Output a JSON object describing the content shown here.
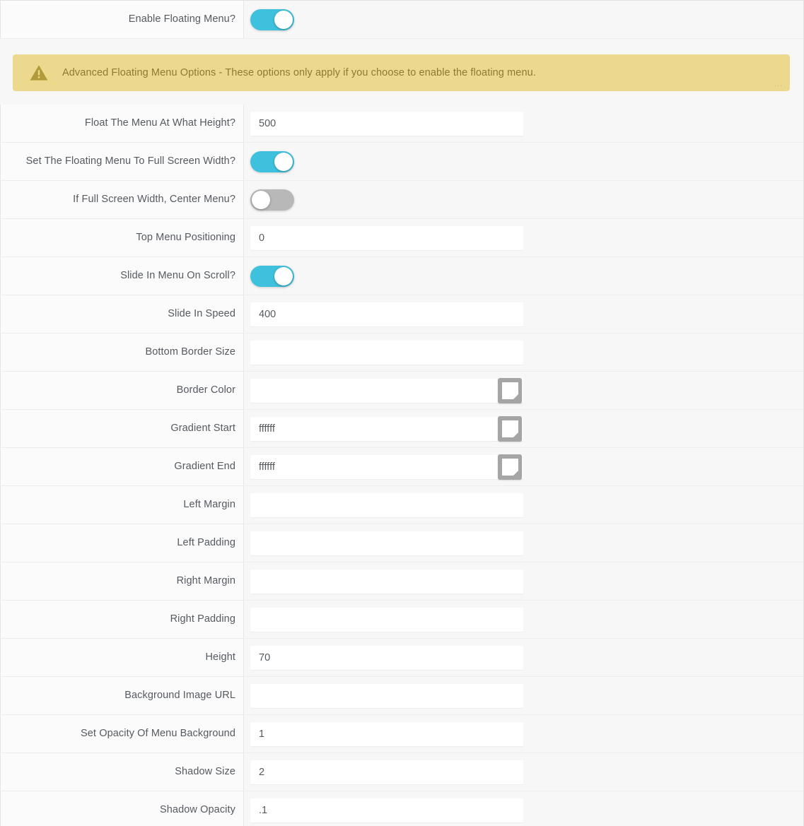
{
  "theme": {
    "accent_on": "#3ec1dd",
    "accent_off": "#b8b8b8",
    "banner_bg": "#ecd98e",
    "banner_text": "#8e7b33",
    "page_bg": "#f7f7f7",
    "row_bg": "#fbfbfb",
    "input_bg": "#ffffff",
    "label_text": "#555a60",
    "swatch_border": "#a5a5a5"
  },
  "top_section": {
    "rows": [
      {
        "label": "Enable Floating Menu?",
        "type": "toggle",
        "state": "on",
        "name": "enable-floating-menu"
      }
    ]
  },
  "banner": {
    "icon": "warning-triangle-icon",
    "text": "Advanced Floating Menu Options - These options only apply if you choose to enable the floating menu.",
    "ellipsis": "..."
  },
  "settings_section": {
    "rows": [
      {
        "label": "Float The Menu At What Height?",
        "type": "text",
        "value": "500",
        "placeholder": "",
        "name": "float-menu-height"
      },
      {
        "label": "Set The Floating Menu To Full Screen Width?",
        "type": "toggle",
        "state": "on",
        "name": "full-screen-width"
      },
      {
        "label": "If Full Screen Width, Center Menu?",
        "type": "toggle",
        "state": "off",
        "name": "center-menu"
      },
      {
        "label": "Top Menu Positioning",
        "type": "text",
        "value": "0",
        "placeholder": "",
        "name": "top-menu-positioning"
      },
      {
        "label": "Slide In Menu On Scroll?",
        "type": "toggle",
        "state": "on",
        "name": "slide-in-on-scroll"
      },
      {
        "label": "Slide In Speed",
        "type": "text",
        "value": "400",
        "placeholder": "",
        "name": "slide-in-speed"
      },
      {
        "label": "Bottom Border Size",
        "type": "text",
        "value": "",
        "placeholder": "",
        "name": "bottom-border-size"
      },
      {
        "label": "Border Color",
        "type": "color",
        "value": "",
        "placeholder": "",
        "name": "border-color"
      },
      {
        "label": "Gradient Start",
        "type": "color",
        "value": "ffffff",
        "placeholder": "",
        "name": "gradient-start"
      },
      {
        "label": "Gradient End",
        "type": "color",
        "value": "ffffff",
        "placeholder": "",
        "name": "gradient-end"
      },
      {
        "label": "Left Margin",
        "type": "text",
        "value": "",
        "placeholder": "",
        "name": "left-margin"
      },
      {
        "label": "Left Padding",
        "type": "text",
        "value": "",
        "placeholder": "",
        "name": "left-padding"
      },
      {
        "label": "Right Margin",
        "type": "text",
        "value": "",
        "placeholder": "",
        "name": "right-margin"
      },
      {
        "label": "Right Padding",
        "type": "text",
        "value": "",
        "placeholder": "",
        "name": "right-padding"
      },
      {
        "label": "Height",
        "type": "text",
        "value": "70",
        "placeholder": "",
        "name": "height"
      },
      {
        "label": "Background Image URL",
        "type": "text",
        "value": "",
        "placeholder": "",
        "name": "background-image-url"
      },
      {
        "label": "Set Opacity Of Menu Background",
        "type": "text",
        "value": "1",
        "placeholder": "",
        "name": "menu-background-opacity"
      },
      {
        "label": "Shadow Size",
        "type": "text",
        "value": "2",
        "placeholder": "",
        "name": "shadow-size"
      },
      {
        "label": "Shadow Opacity",
        "type": "text",
        "value": ".1",
        "placeholder": "",
        "name": "shadow-opacity"
      }
    ]
  }
}
